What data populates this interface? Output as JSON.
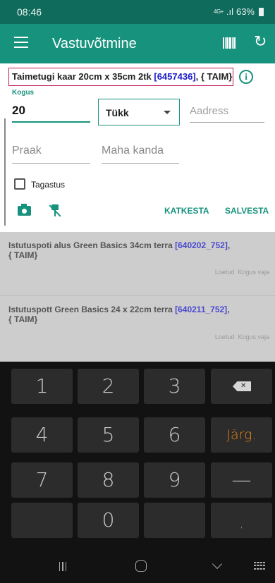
{
  "status_bar": {
    "time": "08:46",
    "network": "4G+",
    "signal": ".ıl",
    "battery": "63%"
  },
  "app_bar": {
    "title": "Vastuvõtmine",
    "icons": [
      "menu-icon",
      "barcode-icon",
      "refresh-icon"
    ]
  },
  "product": {
    "name": "Taimetugi kaar 20cm x 35cm 2tk ",
    "code": "[6457436]",
    "suffix": ", { TAIM}"
  },
  "form": {
    "quantity_label": "Kogus",
    "quantity_value": "20",
    "unit": "Tükk",
    "address_placeholder": "Aadress",
    "praak_placeholder": "Praak",
    "mahakanda_placeholder": "Maha kanda",
    "return_label": "Tagastus",
    "return_checked": false,
    "cancel_label": "KATKESTA",
    "save_label": "SALVESTA"
  },
  "list": [
    {
      "name": "Istutuspoti alus Green Basics 34cm terra ",
      "code": "[640202_752]",
      "suffix": ",",
      "line2": "{ TAIM}",
      "meta_read": "Loetud",
      "meta_qty": "Kogus vaja"
    },
    {
      "name": "Istutuspott Green Basics 24 x 22cm terra ",
      "code": "[640211_752]",
      "suffix": ",",
      "line2": "{ TAIM}",
      "meta_read": "Loetud",
      "meta_qty": "Kogus vaja"
    }
  ],
  "keyboard": {
    "row1": [
      "1",
      "2",
      "3"
    ],
    "row2": [
      "4",
      "5",
      "6"
    ],
    "row3": [
      "7",
      "8",
      "9"
    ],
    "row4": [
      "0"
    ],
    "next_label": "Järg.",
    "minus_label": "—",
    "comma_label": ",",
    "backspace_icon": "backspace-icon"
  },
  "colors": {
    "primary": "#17927d",
    "status_bar": "#0f6b5b",
    "product_border": "#c2185b",
    "code_text": "#1a1ac8",
    "accent_key": "#e0821a"
  }
}
